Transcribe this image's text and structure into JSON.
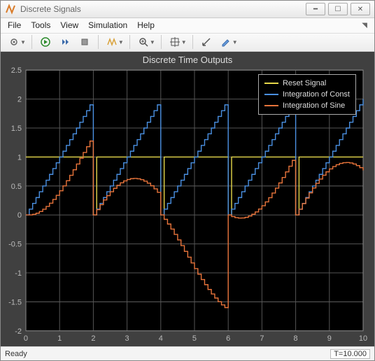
{
  "window": {
    "title": "Discrete Signals"
  },
  "menu": {
    "file": "File",
    "tools": "Tools",
    "view": "View",
    "simulation": "Simulation",
    "help": "Help"
  },
  "status": {
    "ready": "Ready",
    "time": "T=10.000"
  },
  "chart_data": {
    "type": "line",
    "title": "Discrete Time Outputs",
    "xlabel": "",
    "ylabel": "",
    "xlim": [
      0,
      10
    ],
    "ylim": [
      -2,
      2.5
    ],
    "xticks": [
      0,
      1,
      2,
      3,
      4,
      5,
      6,
      7,
      8,
      9,
      10
    ],
    "yticks": [
      -2,
      -1.5,
      -1,
      -0.5,
      0,
      0.5,
      1,
      1.5,
      2,
      2.5
    ],
    "legend": {
      "position": "northeast",
      "entries": [
        "Reset Signal",
        "Integration of Const",
        "Integration of Sine"
      ]
    },
    "colors": {
      "reset": "#e6d84a",
      "const": "#4a90e2",
      "sine": "#e8743b"
    },
    "dt": 0.1,
    "resets": [
      2,
      4,
      6,
      8
    ],
    "series_description": {
      "Reset Signal": "1 for all t, drops to 0 for one sample at each reset time",
      "Integration of Const": "discrete cumulative sum of 1*dt, resets to 0 at resets; climbs 0→~1.9 each 2s window",
      "Integration of Sine": "discrete cumulative sum of sin(t)*dt, resets to 0 at resets; peaks ~1.25 (0-2), ~0.6 (2-4), dips to ~-1.6 (4-6), ~0.9 (6-8 and 8-10)"
    }
  }
}
